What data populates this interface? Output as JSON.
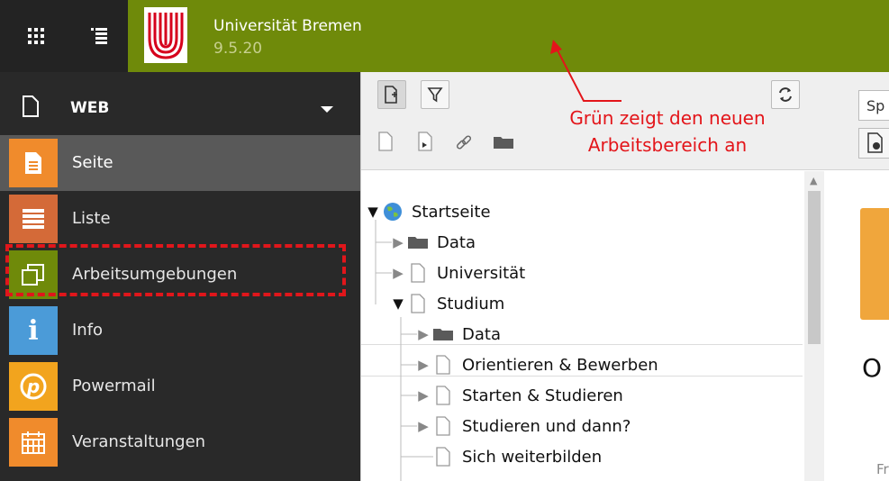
{
  "topbar": {
    "site_name": "Universität Bremen",
    "version": "9.5.20",
    "icons": [
      "grid-menu-icon",
      "list-menu-icon",
      "university-logo-icon"
    ],
    "accent_color": "#6f8a0a"
  },
  "sidebar": {
    "group_label": "WEB",
    "modules": [
      {
        "label": "Seite",
        "icon": "page-icon",
        "color": "#f08b2c"
      },
      {
        "label": "Liste",
        "icon": "list-icon",
        "color": "#d46a38"
      },
      {
        "label": "Arbeitsumgebungen",
        "icon": "workspaces-icon",
        "color": "#6f8a0a"
      },
      {
        "label": "Info",
        "icon": "info-icon",
        "color": "#4b9bd8"
      },
      {
        "label": "Powermail",
        "icon": "powermail-icon",
        "color": "#f2a41e"
      },
      {
        "label": "Veranstaltungen",
        "icon": "calendar-icon",
        "color": "#f08b2c"
      }
    ]
  },
  "annotation": {
    "line1": "Grün zeigt den neuen",
    "line2": "Arbeitsbereich an",
    "color": "#e3151a"
  },
  "tree": {
    "nodes": [
      {
        "label": "Startseite",
        "level": 0,
        "toggle": "open",
        "icon": "globe-icon"
      },
      {
        "label": "Data",
        "level": 1,
        "toggle": "closed",
        "icon": "folder-icon"
      },
      {
        "label": "Universität",
        "level": 1,
        "toggle": "closed",
        "icon": "page-icon"
      },
      {
        "label": "Studium",
        "level": 1,
        "toggle": "open",
        "icon": "page-icon"
      },
      {
        "label": "Data",
        "level": 2,
        "toggle": "closed",
        "icon": "folder-icon"
      },
      {
        "label": "Orientieren & Bewerben",
        "level": 2,
        "toggle": "closed",
        "icon": "page-icon"
      },
      {
        "label": "Starten & Studieren",
        "level": 2,
        "toggle": "closed",
        "icon": "page-icon"
      },
      {
        "label": "Studieren und dann?",
        "level": 2,
        "toggle": "closed",
        "icon": "page-icon"
      },
      {
        "label": "Sich weiterbilden",
        "level": 2,
        "toggle": "none",
        "icon": "page-icon"
      }
    ]
  },
  "content": {
    "input_partial": "Sp",
    "heading_partial": "O",
    "text_partial": "Fr"
  }
}
